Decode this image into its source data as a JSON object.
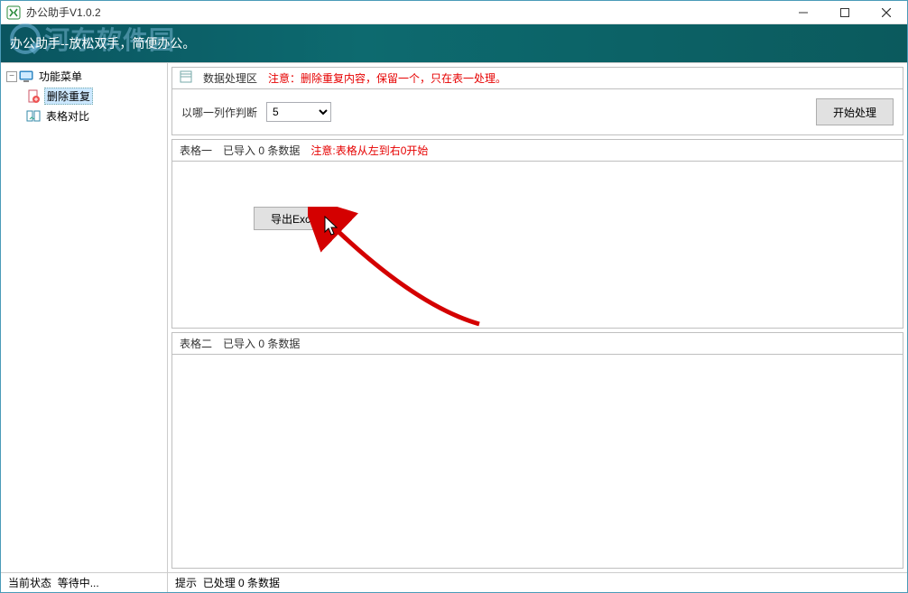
{
  "window": {
    "title": "办公助手V1.0.2"
  },
  "banner": {
    "text": "办公助手--放松双手，简便办公。",
    "watermark": "河东软件园"
  },
  "sidebar": {
    "root": "功能菜单",
    "items": [
      {
        "label": "删除重复"
      },
      {
        "label": "表格对比"
      }
    ]
  },
  "processing": {
    "section_title": "数据处理区",
    "note": "注意：删除重复内容，保留一个，只在表一处理。",
    "judge_label": "以哪一列作判断",
    "judge_value": "5",
    "start_button": "开始处理"
  },
  "table1": {
    "name": "表格一",
    "status": "已导入 0 条数据",
    "note": "注意:表格从左到右0开始",
    "export_button": "导出Excel"
  },
  "table2": {
    "name": "表格二",
    "status": "已导入 0 条数据"
  },
  "statusbar": {
    "state_label": "当前状态",
    "state_value": "等待中...",
    "hint_label": "提示",
    "hint_value": "已处理 0 条数据"
  }
}
